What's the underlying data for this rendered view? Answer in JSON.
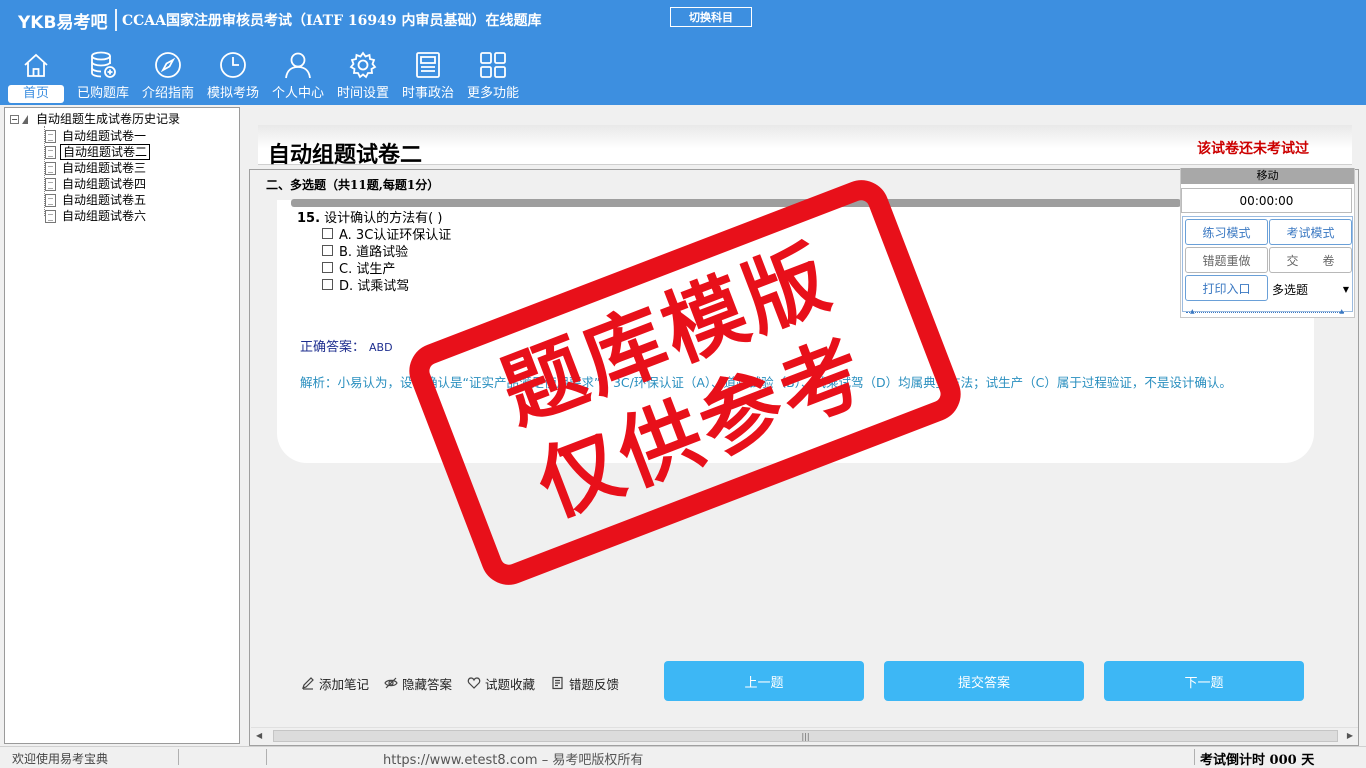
{
  "header": {
    "brand": "YKB易考吧",
    "title": "CCAA国家注册审核员考试（IATF 16949 内审员基础）在线题库",
    "switch_subject": "切换科目",
    "nav": [
      {
        "label": "首页",
        "icon": "home-icon"
      },
      {
        "label": "已购题库",
        "icon": "database-icon"
      },
      {
        "label": "介绍指南",
        "icon": "compass-icon"
      },
      {
        "label": "模拟考场",
        "icon": "clock-icon"
      },
      {
        "label": "个人中心",
        "icon": "user-icon"
      },
      {
        "label": "时间设置",
        "icon": "gear-icon"
      },
      {
        "label": "时事政治",
        "icon": "news-icon"
      },
      {
        "label": "更多功能",
        "icon": "grid-icon"
      }
    ],
    "active_nav": "首页"
  },
  "tree": {
    "root": "自动组题生成试卷历史记录",
    "items": [
      "自动组题试卷一",
      "自动组题试卷二",
      "自动组题试卷三",
      "自动组题试卷四",
      "自动组题试卷五",
      "自动组题试卷六"
    ],
    "selected": "自动组题试卷二"
  },
  "paper": {
    "title": "自动组题试卷二",
    "status": "该试卷还未考试过",
    "section": "二、多选题（共11题,每题1分）"
  },
  "question": {
    "number": "15.",
    "stem": "设计确认的方法有( )",
    "options": [
      "A. 3C认证环保认证",
      "B. 道路试验",
      "C. 试生产",
      "D. 试乘试驾"
    ],
    "answer_label": "正确答案：",
    "answer_value": "ABD",
    "analysis": "解析：小易认为，设计确认是“证实产品满足使用要求”。3C/环保认证（A）、道路试验（B）、试乘试驾（D）均属典型方法；试生产（C）属于过程验证，不是设计确认。"
  },
  "control": {
    "move": "移动",
    "timer": "00:00:00",
    "practice_mode": "练习模式",
    "exam_mode": "考试模式",
    "redo_wrong": "错题重做",
    "submit_paper": "交　　卷",
    "print": "打印入口",
    "question_type": "多选题"
  },
  "tools": {
    "note": "添加笔记",
    "hide_answer": "隐藏答案",
    "favorite": "试题收藏",
    "feedback": "错题反馈"
  },
  "buttons": {
    "prev": "上一题",
    "submit": "提交答案",
    "next": "下一题"
  },
  "status": {
    "welcome": "欢迎使用易考宝典",
    "copyright": "https://www.etest8.com – 易考吧版权所有",
    "countdown": "考试倒计时 000 天"
  },
  "watermark": {
    "line1": "题库模版",
    "line2": "仅供参考"
  },
  "colors": {
    "header_bg": "#3d8fe0",
    "primary_button": "#3db7f5",
    "status_red": "#cc0000",
    "stamp_red": "#e8101a"
  }
}
